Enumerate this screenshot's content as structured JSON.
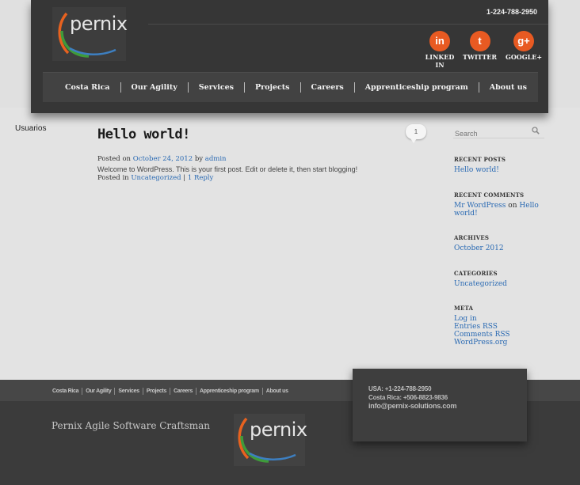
{
  "header": {
    "logo_text": "pernix",
    "phone": "1-224-788-2950"
  },
  "social": [
    {
      "icon": "linkedin-icon",
      "glyph": "in",
      "label": "LINKED IN"
    },
    {
      "icon": "tumblr-icon",
      "glyph": "t",
      "label": "TWITTER"
    },
    {
      "icon": "google-plus-icon",
      "glyph": "g+",
      "label": "GOOGLE+"
    }
  ],
  "nav": [
    "Costa Rica",
    "Our Agility",
    "Services",
    "Projects",
    "Careers",
    "Apprenticeship program",
    "About us"
  ],
  "sidebar_left": {
    "usuarios": "Usuarios"
  },
  "post": {
    "title": "Hello world!",
    "comments_count": "1",
    "posted_on_label": "Posted on",
    "date": "October 24, 2012",
    "by_label": "by",
    "author": "admin",
    "content": "Welcome to WordPress. This is your first post. Edit or delete it, then start blogging!",
    "posted_in_label": "Posted in",
    "category": "Uncategorized",
    "separator": "|",
    "reply": "1 Reply"
  },
  "sidebar": {
    "search_placeholder": "Search",
    "recent_posts_title": "RECENT POSTS",
    "recent_posts": [
      "Hello world!"
    ],
    "recent_comments_title": "RECENT COMMENTS",
    "comment_author": "Mr WordPress",
    "comment_on": "on",
    "comment_post_line1": "Hello",
    "comment_post_line2": "world!",
    "archives_title": "ARCHIVES",
    "archives": [
      "October 2012"
    ],
    "categories_title": "CATEGORIES",
    "categories": [
      "Uncategorized"
    ],
    "meta_title": "META",
    "meta_links": [
      "Log in",
      "Entries RSS",
      "Comments RSS",
      "WordPress.org"
    ]
  },
  "footer": {
    "nav": [
      "Costa Rica",
      "Our Agility",
      "Services",
      "Projects",
      "Careers",
      "Apprenticeship program",
      "About us"
    ],
    "contact": [
      "USA: +1-224-788-2950",
      "Costa Rica: +506-8823-9836",
      "info@pernix-solutions.com"
    ],
    "tagline": "Pernix Agile Software Craftsman",
    "logo_text": "pernix"
  },
  "colors": {
    "accent_orange": "#e85a22",
    "link_blue": "#2a6ab3",
    "logo_green": "#3f9b3a",
    "logo_orange": "#e8621f",
    "logo_blue": "#3d7fc1"
  }
}
